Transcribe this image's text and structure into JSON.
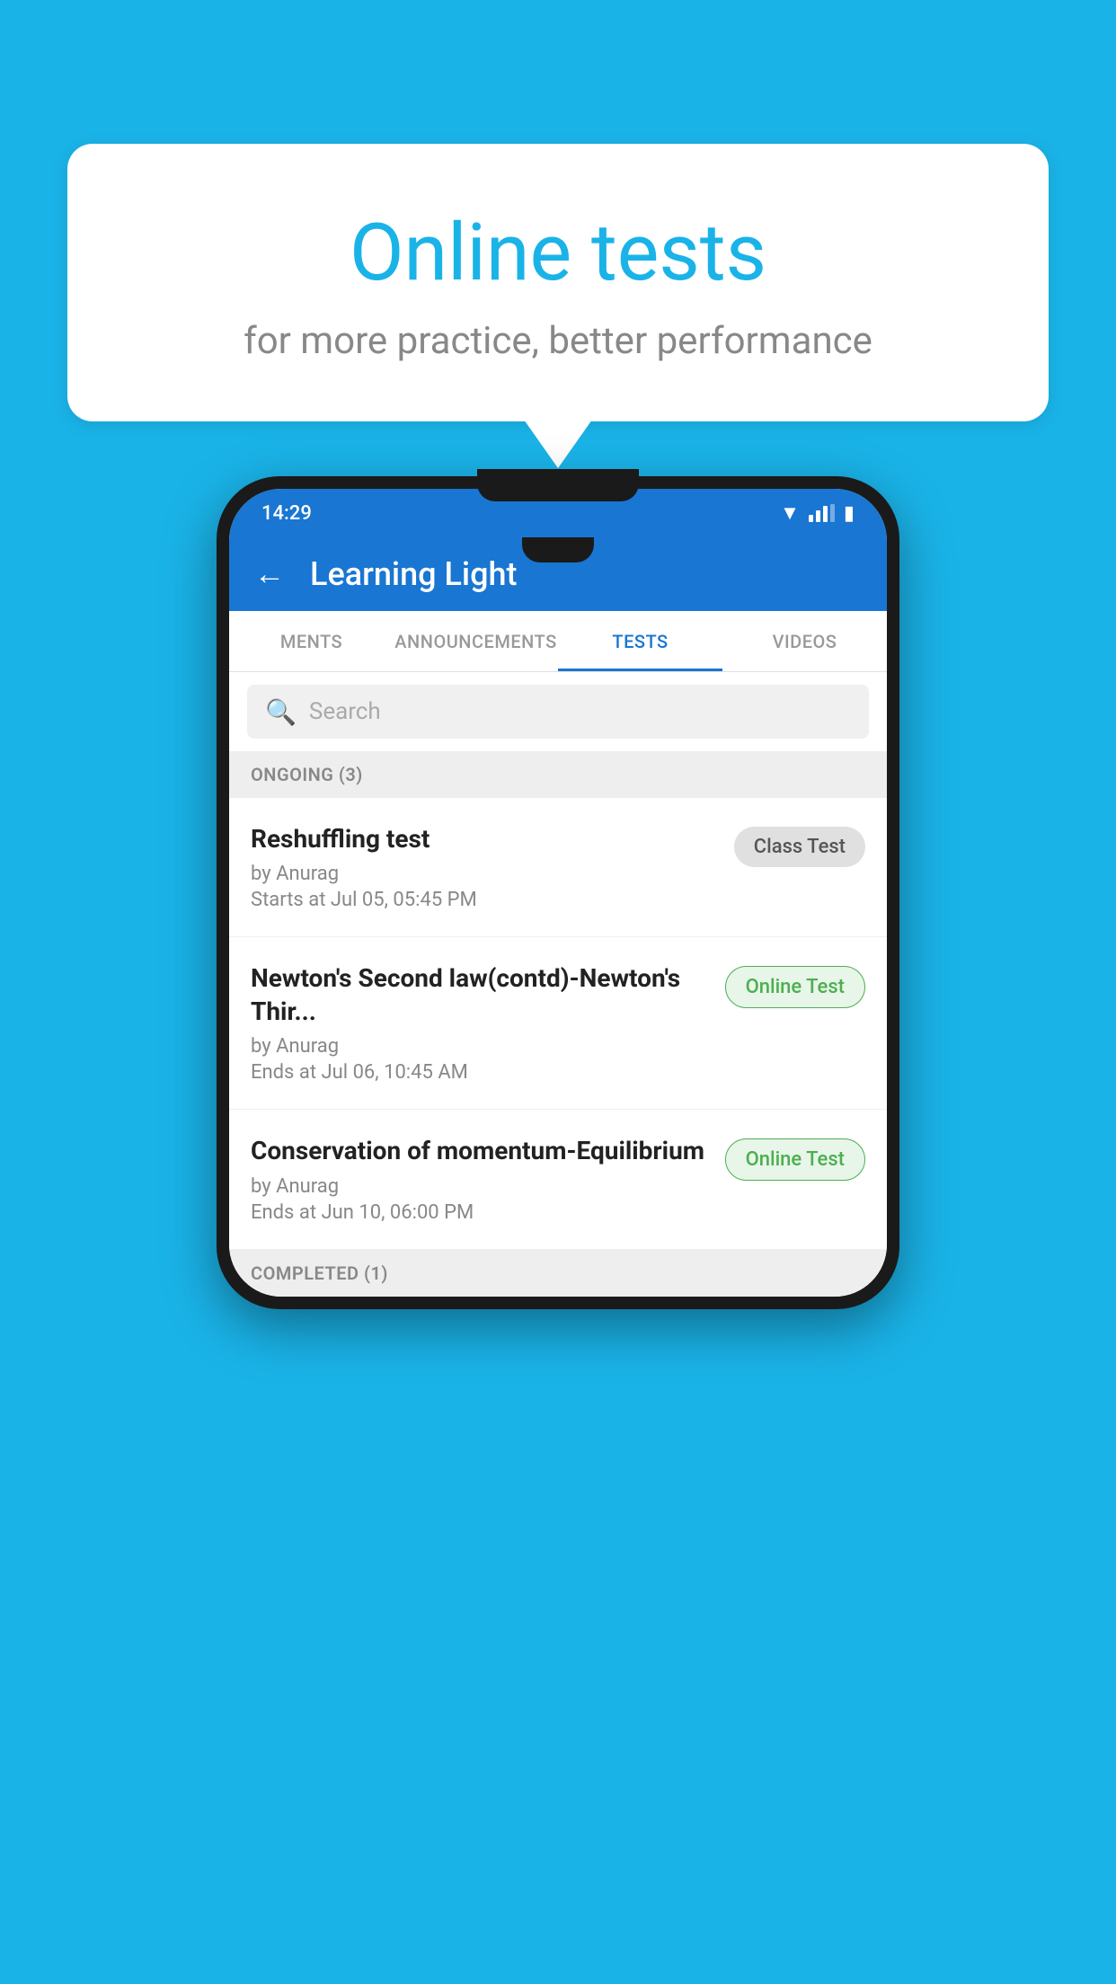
{
  "background": {
    "color": "#1ab3e8"
  },
  "speech_bubble": {
    "title": "Online tests",
    "subtitle": "for more practice, better performance"
  },
  "phone": {
    "status_bar": {
      "time": "14:29",
      "icons": [
        "wifi",
        "signal",
        "battery"
      ]
    },
    "app_header": {
      "title": "Learning Light",
      "back_label": "←"
    },
    "tabs": [
      {
        "label": "MENTS",
        "active": false
      },
      {
        "label": "ANNOUNCEMENTS",
        "active": false
      },
      {
        "label": "TESTS",
        "active": true
      },
      {
        "label": "VIDEOS",
        "active": false
      }
    ],
    "search": {
      "placeholder": "Search"
    },
    "sections": [
      {
        "title": "ONGOING (3)",
        "tests": [
          {
            "name": "Reshuffling test",
            "by": "by Anurag",
            "date": "Starts at  Jul 05, 05:45 PM",
            "badge": "Class Test",
            "badge_type": "class"
          },
          {
            "name": "Newton's Second law(contd)-Newton's Thir...",
            "by": "by Anurag",
            "date": "Ends at  Jul 06, 10:45 AM",
            "badge": "Online Test",
            "badge_type": "online"
          },
          {
            "name": "Conservation of momentum-Equilibrium",
            "by": "by Anurag",
            "date": "Ends at  Jun 10, 06:00 PM",
            "badge": "Online Test",
            "badge_type": "online"
          }
        ]
      }
    ],
    "completed_section": {
      "title": "COMPLETED (1)"
    }
  }
}
